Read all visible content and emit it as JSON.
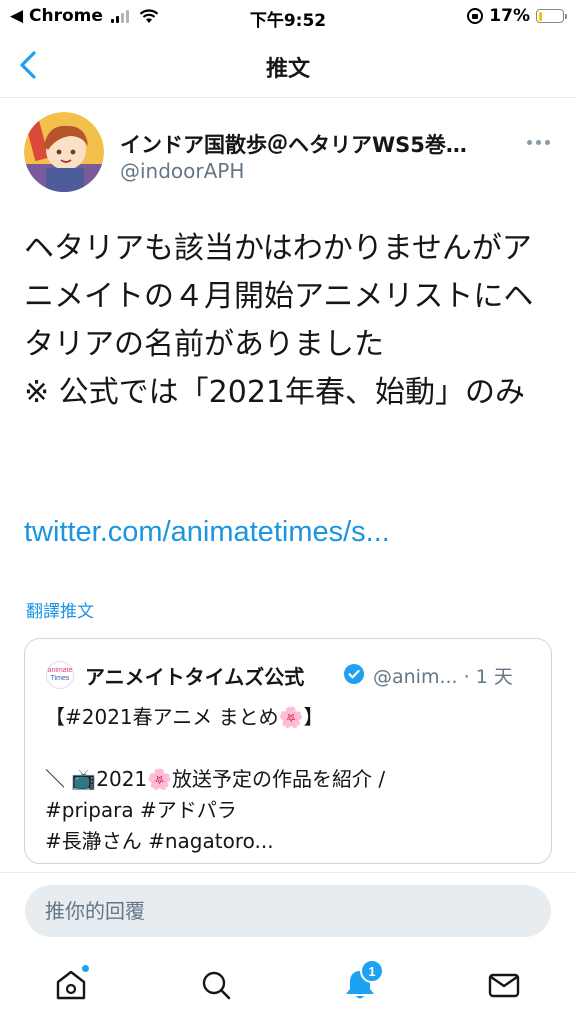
{
  "status_bar": {
    "back_app": "◀ Chrome",
    "time": "下午9:52",
    "battery_percent": "17%",
    "battery_level": 0.17
  },
  "nav": {
    "title": "推文",
    "back_icon": "chevron-left-icon"
  },
  "author": {
    "name": "インドア国散歩＠ヘタリアWS5巻…",
    "handle": "@indoorAPH"
  },
  "tweet": {
    "text": "ヘタリアも該当かはわかりませんがアニメイトの４月開始アニメリストにヘタリアの名前がありました\n※ 公式では「2021年春、始動」のみ",
    "link": "twitter.com/animatetimes/s...",
    "translate_label": "翻譯推文"
  },
  "quote": {
    "avatar_top": "animate",
    "avatar_bottom": "Times",
    "name": "アニメイトタイムズ公式",
    "handle_time": "@anim... · 1 天",
    "text": "【#2021春アニメ まとめ🌸】\n\n＼ 📺2021🌸放送予定の作品を紹介 /\n#pripara #アドパラ\n#長瀞さん #nagatoro..."
  },
  "reply": {
    "placeholder": "推你的回覆"
  },
  "tab_bar": {
    "notification_count": "1",
    "icons": [
      "home-icon",
      "search-icon",
      "bell-icon",
      "mail-icon"
    ],
    "accent": "#1da1f2"
  },
  "colors": {
    "accent": "#1b95e0",
    "muted_text": "#657786",
    "input_bg": "#e6ecf0"
  }
}
